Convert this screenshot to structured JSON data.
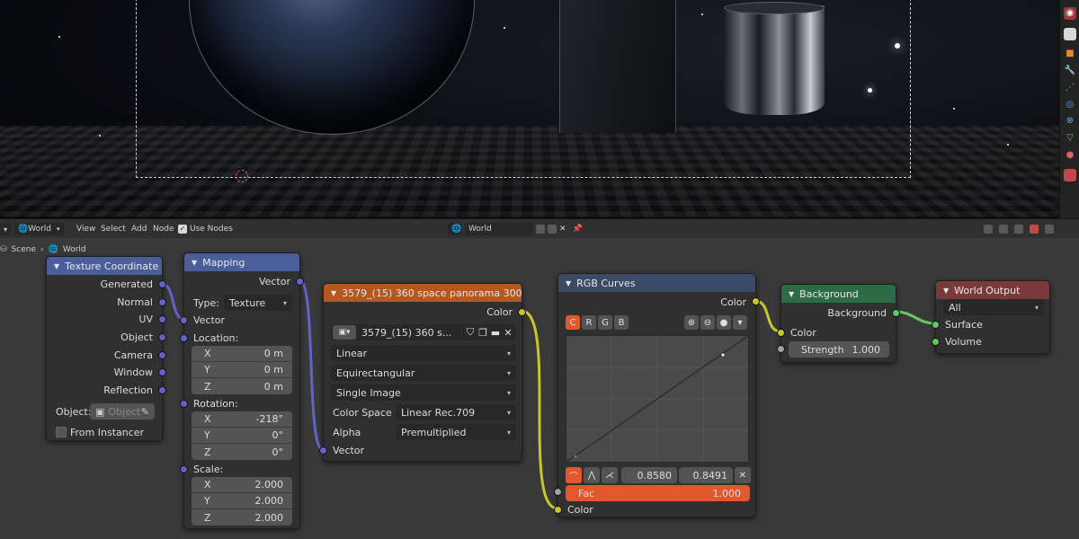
{
  "header": {
    "editor_type": "World",
    "menu": [
      "View",
      "Select",
      "Add",
      "Node"
    ],
    "use_nodes_label": "Use Nodes",
    "world_name": "World"
  },
  "breadcrumb": [
    "Scene",
    "World"
  ],
  "nodes": {
    "texture_coordinate": {
      "title": "Texture Coordinate",
      "outputs": [
        "Generated",
        "Normal",
        "UV",
        "Object",
        "Camera",
        "Window",
        "Reflection"
      ],
      "object_label": "Object:",
      "object_placeholder": "Object",
      "from_instancer": "From Instancer"
    },
    "mapping": {
      "title": "Mapping",
      "output": "Vector",
      "type_label": "Type:",
      "type_value": "Texture",
      "vector_input": "Vector",
      "location_label": "Location:",
      "location": [
        {
          "axis": "X",
          "value": "0 m"
        },
        {
          "axis": "Y",
          "value": "0 m"
        },
        {
          "axis": "Z",
          "value": "0 m"
        }
      ],
      "rotation_label": "Rotation:",
      "rotation": [
        {
          "axis": "X",
          "value": "-218°"
        },
        {
          "axis": "Y",
          "value": "0°"
        },
        {
          "axis": "Z",
          "value": "0°"
        }
      ],
      "scale_label": "Scale:",
      "scale": [
        {
          "axis": "X",
          "value": "2.000"
        },
        {
          "axis": "Y",
          "value": "2.000"
        },
        {
          "axis": "Z",
          "value": "2.000"
        }
      ]
    },
    "image_texture": {
      "title": "3579_(15) 360 space panorama 3005....",
      "output": "Color",
      "image_name": "3579_(15) 360 s...",
      "interpolation": "Linear",
      "projection": "Equirectangular",
      "source": "Single Image",
      "color_space_label": "Color Space",
      "color_space": "Linear Rec.709",
      "alpha_label": "Alpha",
      "alpha": "Premultiplied",
      "vector_input": "Vector"
    },
    "rgb_curves": {
      "title": "RGB Curves",
      "output": "Color",
      "channels": [
        "C",
        "R",
        "G",
        "B"
      ],
      "point_x": "0.8580",
      "point_y": "0.8491",
      "fac_label": "Fac",
      "fac_value": "1.000",
      "fac_fraction": 1.0,
      "color_input": "Color"
    },
    "background": {
      "title": "Background",
      "output": "Background",
      "color_input": "Color",
      "strength_label": "Strength",
      "strength_value": "1.000"
    },
    "world_output": {
      "title": "World Output",
      "target": "All",
      "surface": "Surface",
      "volume": "Volume"
    }
  },
  "colors": {
    "vector_socket": "#6363c7",
    "color_socket": "#c7c729",
    "shader_socket": "#63c763",
    "input_header": "#7a3a3a",
    "texture_header": "#b5571f",
    "converter_header": "#3b4a66",
    "vector_header": "#4a5f9a",
    "shader_header": "#2c6b45",
    "output_header": "#7a3a3a",
    "accent": "#e1582c"
  }
}
